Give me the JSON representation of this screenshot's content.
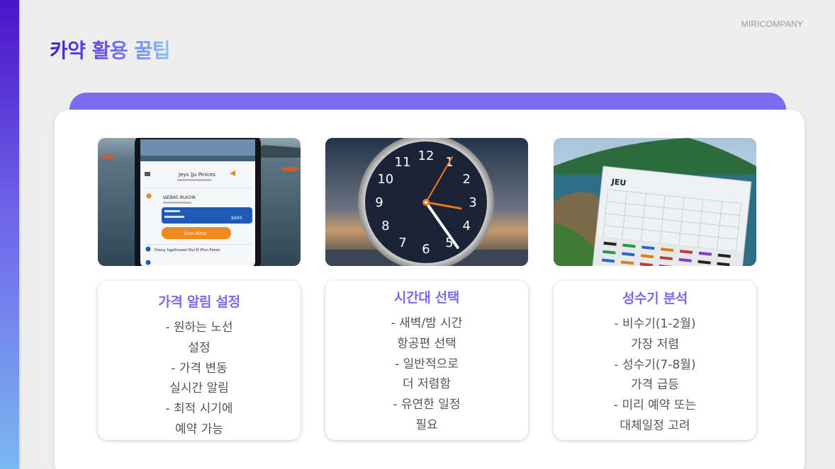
{
  "brand": "MIRICOMPANY",
  "title": "카약 활용 꿀팁",
  "cards": [
    {
      "title": "가격 알림 설정",
      "lines": [
        "- 원하는 노선",
        "설정",
        "- 가격 변동",
        "실시간 알림",
        "- 최적 시기에",
        "예약 가능"
      ],
      "image": {
        "icon": "phone-app-photo",
        "app_title": "Jeys ]ju Pinices",
        "flight_label": "ΙΔΕΒΑ5 ΘLΚΟΙΚ",
        "price_label": "$600",
        "button_label": "Sven Altter",
        "footer_text": "Dieny hgeSnoed ISvl Ð Plsn Fetsh"
      }
    },
    {
      "title": "시간대 선택",
      "lines": [
        "- 새벽/밤 시간",
        "항공편 선택",
        "- 일반적으로",
        "더 저렴함",
        "- 유연한 일정",
        "필요"
      ],
      "image": {
        "icon": "clock-photo",
        "clock_numbers": [
          "12",
          "1",
          "2",
          "3",
          "4",
          "5",
          "6",
          "7",
          "8",
          "9",
          "10",
          "11"
        ]
      }
    },
    {
      "title": "성수기 분석",
      "lines": [
        "- 비수기(1-2월)",
        "가장 저렴",
        "- 성수기(7-8월)",
        "가격 급등",
        "- 미리 예약 또는",
        "대체일정 고려"
      ],
      "image": {
        "icon": "jeju-calendar-photo",
        "calendar_label": "JEU"
      }
    }
  ],
  "colors": {
    "accent": "#7a6cee",
    "title_start": "#3f1bd0",
    "title_end": "#86c4f5",
    "card_heading": "#7a6be6",
    "body_text": "#555555"
  }
}
